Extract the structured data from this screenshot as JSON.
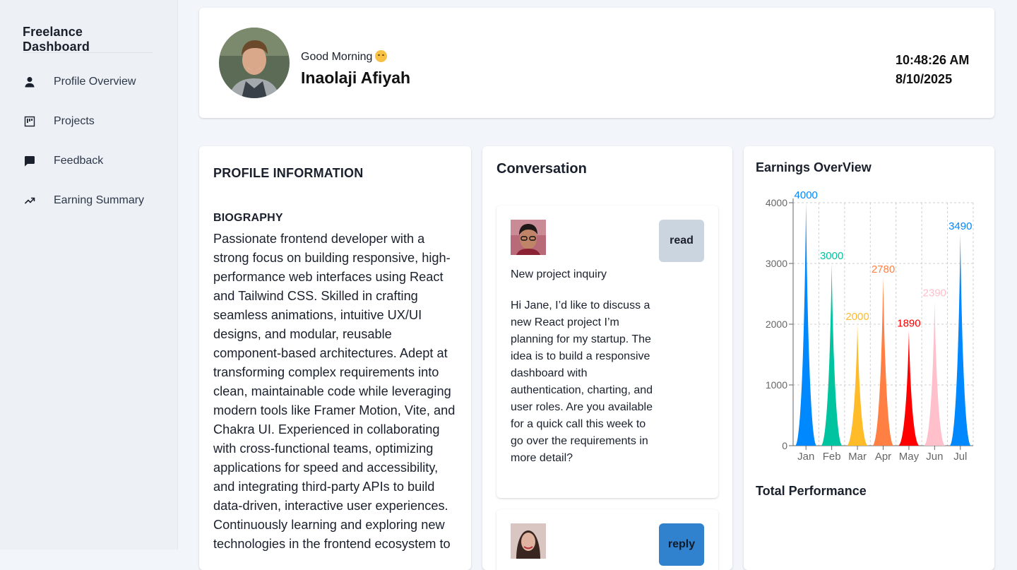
{
  "sidebar": {
    "brand": "Freelance Dashboard",
    "items": [
      {
        "label": "Profile Overview",
        "icon": "user-icon"
      },
      {
        "label": "Projects",
        "icon": "kanban-icon"
      },
      {
        "label": "Feedback",
        "icon": "chat-icon"
      },
      {
        "label": "Earning Summary",
        "icon": "trending-up-icon"
      }
    ]
  },
  "header": {
    "greeting": "Good Morning",
    "name": "Inaolaji Afiyah",
    "time": "10:48:26 AM",
    "date": "8/10/2025"
  },
  "profile": {
    "title": "PROFILE INFORMATION",
    "bio_heading": "BIOGRAPHY",
    "bio": "Passionate frontend developer with a strong focus on building responsive, high-performance web interfaces using React and Tailwind CSS. Skilled in crafting seamless animations, intuitive UX/UI designs, and modular, reusable component-based architectures. Adept at transforming complex requirements into clean, maintainable code while leveraging modern tools like Framer Motion, Vite, and Chakra UI. Experienced in collaborating with cross-functional teams, optimizing applications for speed and accessibility, and integrating third-party APIs to build data-driven, interactive user experiences. Continuously learning and exploring new technologies in the frontend ecosystem to"
  },
  "conversation": {
    "title": "Conversation",
    "messages": [
      {
        "button": "read",
        "subject": "New project inquiry",
        "body": "Hi Jane, I’d like to discuss a new React project I’m planning for my startup. The idea is to build a responsive dashboard with authentication, charting, and user roles. Are you available for a quick call this week to go over the requirements in more detail?"
      },
      {
        "button": "reply"
      }
    ]
  },
  "earnings": {
    "title": "Earnings OverView",
    "performance_title": "Total Performance"
  },
  "chart_data": {
    "type": "area",
    "title": "Earnings OverView",
    "categories": [
      "Jan",
      "Feb",
      "Mar",
      "Apr",
      "May",
      "Jun",
      "Jul"
    ],
    "values": [
      4000,
      3000,
      2000,
      2780,
      1890,
      2390,
      3490
    ],
    "colors": [
      "#0088fe",
      "#00c49f",
      "#ffbb28",
      "#ff8042",
      "#ff0000",
      "#ffc0cb",
      "#0088fe"
    ],
    "yticks": [
      0,
      1000,
      2000,
      3000,
      4000
    ],
    "ylim": [
      0,
      4000
    ],
    "grid": true,
    "data_labels": true
  }
}
